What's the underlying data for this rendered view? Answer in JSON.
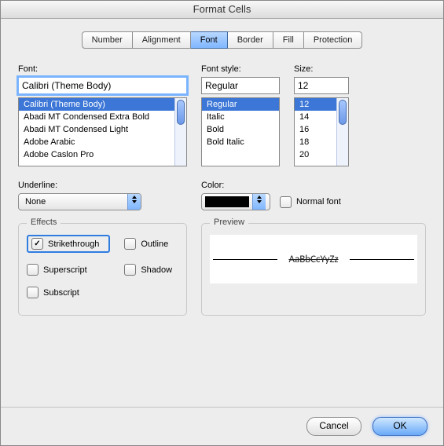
{
  "window": {
    "title": "Format Cells"
  },
  "tabs": [
    {
      "label": "Number"
    },
    {
      "label": "Alignment"
    },
    {
      "label": "Font"
    },
    {
      "label": "Border"
    },
    {
      "label": "Fill"
    },
    {
      "label": "Protection"
    }
  ],
  "font": {
    "label": "Font:",
    "value": "Calibri (Theme Body)",
    "list": [
      "Calibri (Theme Body)",
      "Abadi MT Condensed Extra Bold",
      "Abadi MT Condensed Light",
      "Adobe Arabic",
      "Adobe Caslon Pro"
    ]
  },
  "style": {
    "label": "Font style:",
    "value": "Regular",
    "list": [
      "Regular",
      "Italic",
      "Bold",
      "Bold Italic"
    ]
  },
  "size": {
    "label": "Size:",
    "value": "12",
    "list": [
      "12",
      "14",
      "16",
      "18",
      "20"
    ]
  },
  "underline": {
    "label": "Underline:",
    "value": "None"
  },
  "color": {
    "label": "Color:",
    "normal_label": "Normal font"
  },
  "effects": {
    "legend": "Effects",
    "strikethrough": "Strikethrough",
    "outline": "Outline",
    "superscript": "Superscript",
    "shadow": "Shadow",
    "subscript": "Subscript"
  },
  "preview": {
    "legend": "Preview",
    "sample": "AaBbCcYyZz"
  },
  "buttons": {
    "cancel": "Cancel",
    "ok": "OK"
  }
}
